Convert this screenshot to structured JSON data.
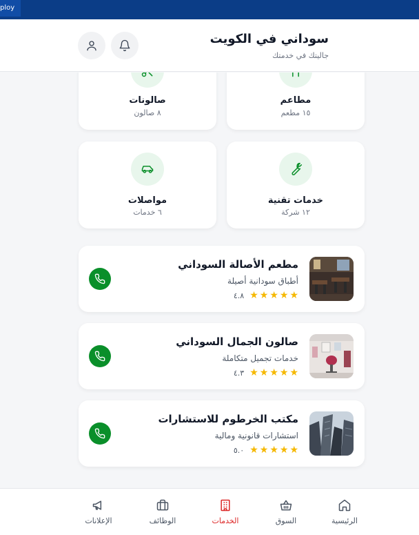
{
  "deploy_tag": "ploy",
  "header": {
    "title": "سوداني في الكويت",
    "subtitle": "جاليتك في خدمتك"
  },
  "categories": [
    {
      "name": "مطاعم",
      "count": "١٥ مطعم",
      "icon": "restaurant-icon"
    },
    {
      "name": "صالونات",
      "count": "٨ صالون",
      "icon": "scissors-icon"
    },
    {
      "name": "خدمات تقنية",
      "count": "١٢ شركة",
      "icon": "wrench-icon"
    },
    {
      "name": "مواصلات",
      "count": "٦ خدمات",
      "icon": "car-icon"
    }
  ],
  "businesses": [
    {
      "name": "مطعم الأصالة السوداني",
      "desc": "أطباق سودانية أصيلة",
      "rating": "٤.٨",
      "stars": 5
    },
    {
      "name": "صالون الجمال السوداني",
      "desc": "خدمات تجميل متكاملة",
      "rating": "٤.٣",
      "stars": 5
    },
    {
      "name": "مكتب الخرطوم للاستشارات",
      "desc": "استشارات قانونية ومالية",
      "rating": "٥.٠",
      "stars": 5
    }
  ],
  "nav": {
    "home": "الرئيسية",
    "market": "السوق",
    "services": "الخدمات",
    "jobs": "الوظائف",
    "ads": "الإعلانات"
  },
  "colors": {
    "accent_green": "#0a8f2a",
    "active_red": "#dc2626",
    "star": "#f5b800"
  }
}
